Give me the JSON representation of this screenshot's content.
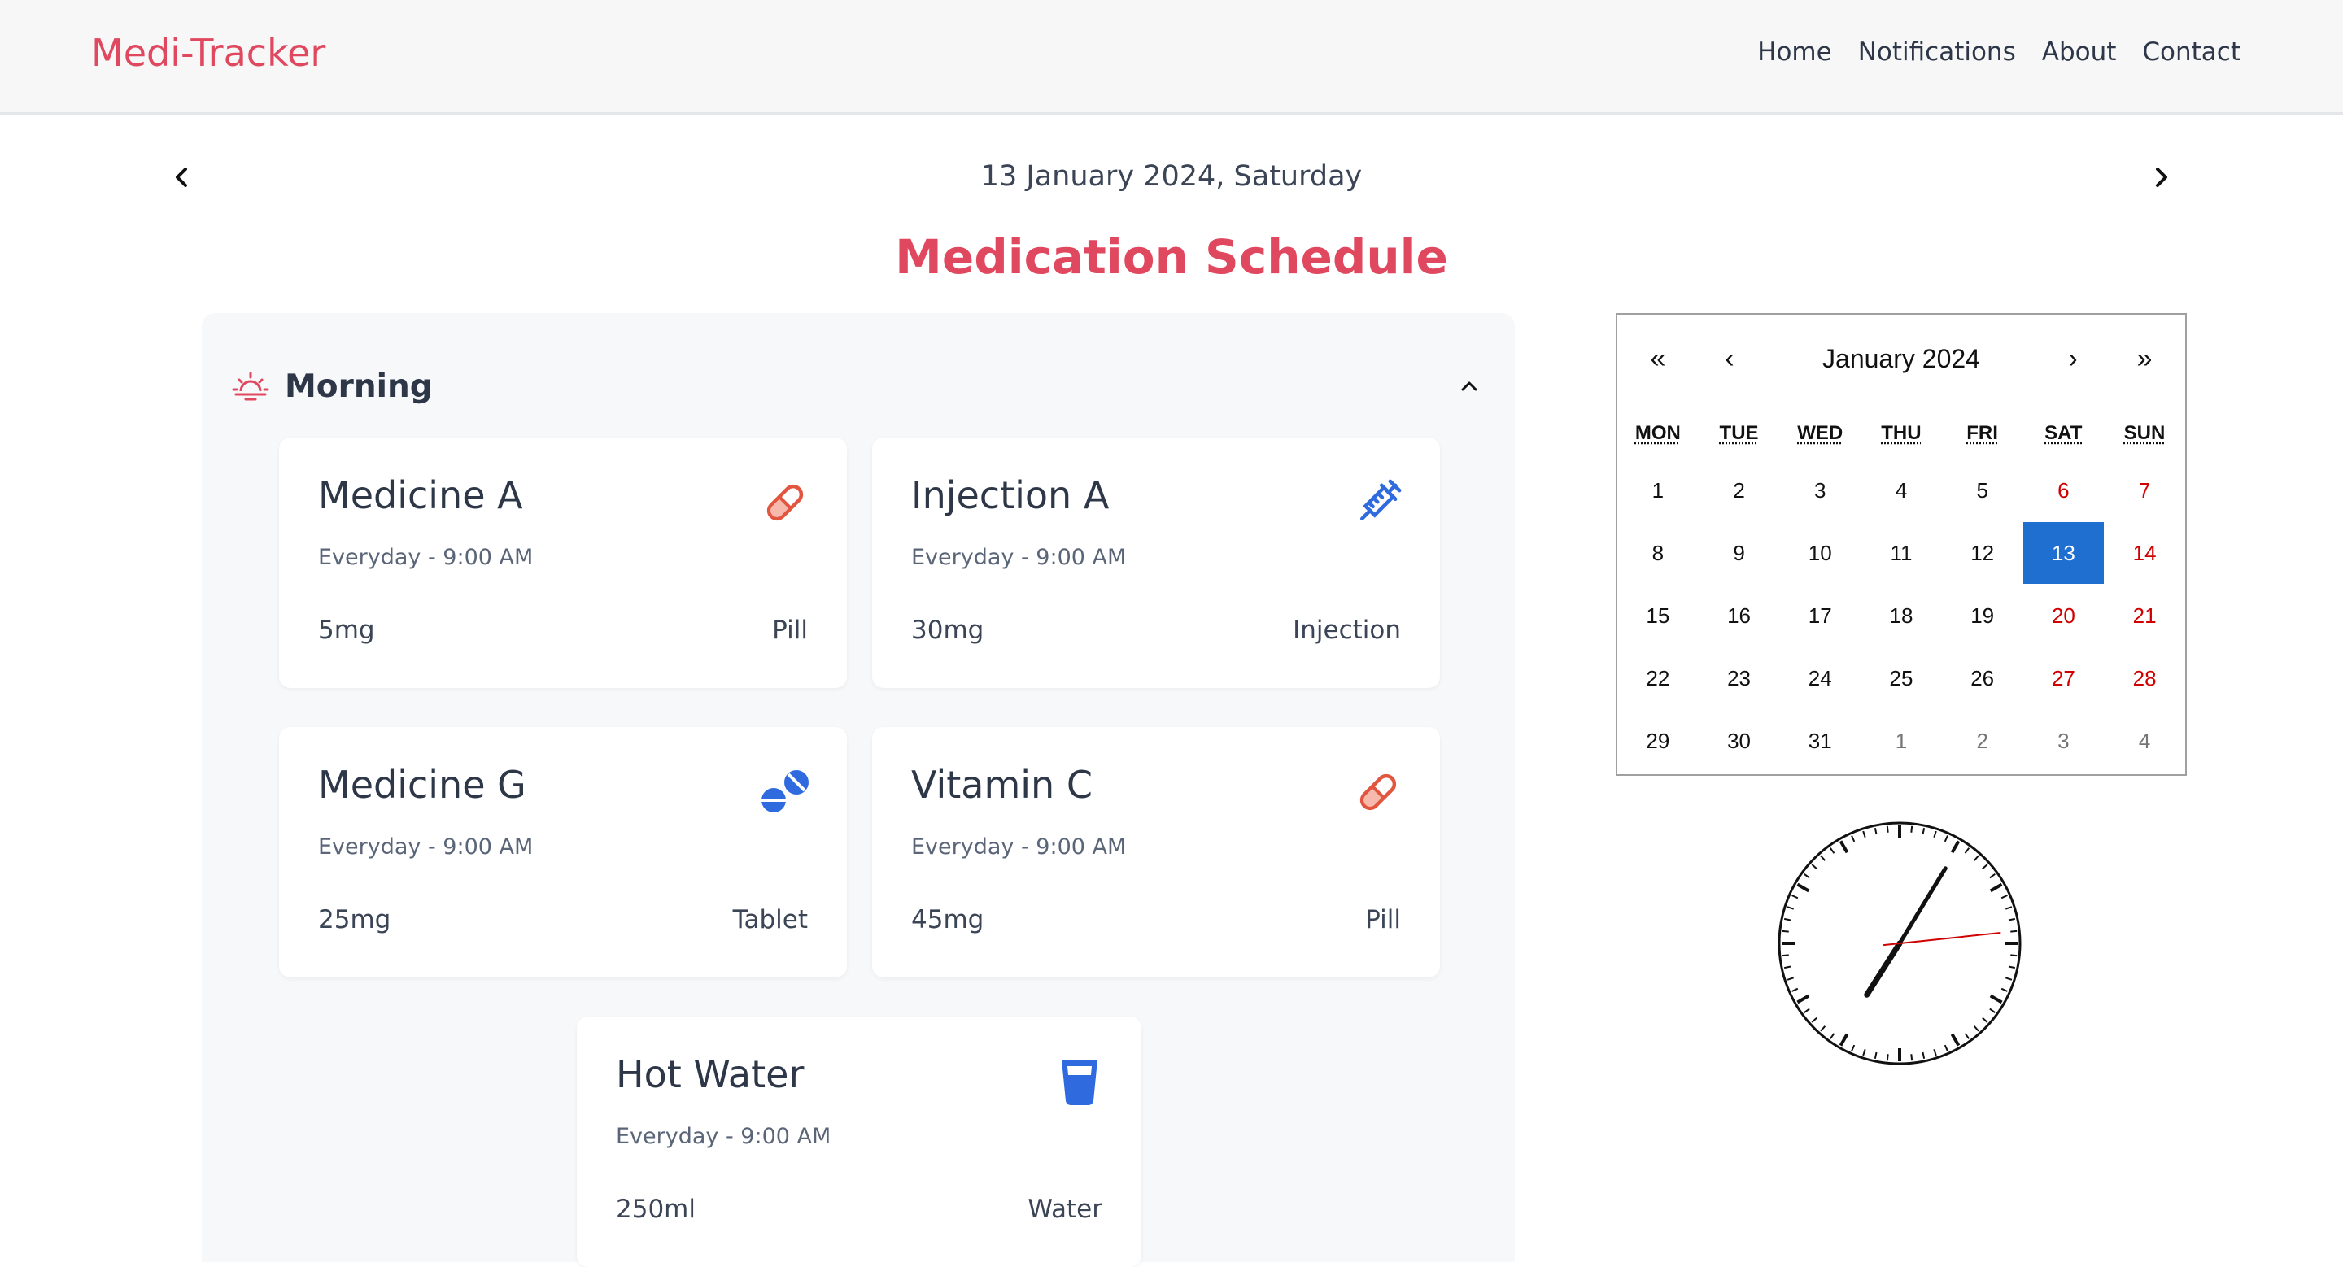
{
  "header": {
    "brand": "Medi-Tracker",
    "nav": [
      "Home",
      "Notifications",
      "About",
      "Contact"
    ]
  },
  "date_bar": {
    "current_date": "13 January 2024, Saturday"
  },
  "page_title": "Medication Schedule",
  "section": {
    "label": "Morning",
    "cards": [
      {
        "name": "Medicine A",
        "schedule": "Everyday - 9:00 AM",
        "dose": "5mg",
        "type": "Pill",
        "icon": "pill-icon",
        "icon_color": "#e2553f"
      },
      {
        "name": "Injection A",
        "schedule": "Everyday - 9:00 AM",
        "dose": "30mg",
        "type": "Injection",
        "icon": "syringe-icon",
        "icon_color": "#2f6bde"
      },
      {
        "name": "Medicine G",
        "schedule": "Everyday - 9:00 AM",
        "dose": "25mg",
        "type": "Tablet",
        "icon": "tablets-icon",
        "icon_color": "#2f6bde"
      },
      {
        "name": "Vitamin C",
        "schedule": "Everyday - 9:00 AM",
        "dose": "45mg",
        "type": "Pill",
        "icon": "pill-icon",
        "icon_color": "#e2553f"
      },
      {
        "name": "Hot Water",
        "schedule": "Everyday - 9:00 AM",
        "dose": "250ml",
        "type": "Water",
        "icon": "glass-icon",
        "icon_color": "#2f6bde"
      }
    ]
  },
  "calendar": {
    "prev_year": "«",
    "prev_month": "‹",
    "month_label": "January 2024",
    "next_month": "›",
    "next_year": "»",
    "weekdays": [
      "MON",
      "TUE",
      "WED",
      "THU",
      "FRI",
      "SAT",
      "SUN"
    ],
    "days": [
      [
        "1",
        "2",
        "3",
        "4",
        "5",
        "6",
        "7"
      ],
      [
        "8",
        "9",
        "10",
        "11",
        "12",
        "13",
        "14"
      ],
      [
        "15",
        "16",
        "17",
        "18",
        "19",
        "20",
        "21"
      ],
      [
        "22",
        "23",
        "24",
        "25",
        "26",
        "27",
        "28"
      ],
      [
        "29",
        "30",
        "31",
        "1",
        "2",
        "3",
        "4"
      ]
    ],
    "selected": "13",
    "selected_color": "#1f6fd0"
  },
  "clock": {
    "hour": 7,
    "minute": 5,
    "second": 14
  },
  "colors": {
    "accent": "#e0485f",
    "weekend": "#d10000"
  }
}
